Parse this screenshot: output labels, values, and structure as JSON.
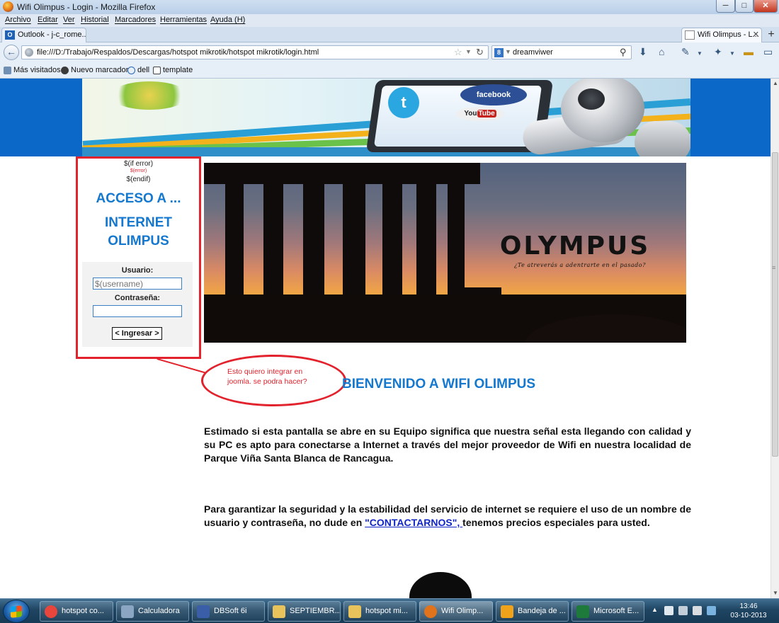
{
  "window": {
    "title": "Wifi Olimpus - Login - Mozilla Firefox",
    "minimize": "─",
    "maximize": "□",
    "close": "✕"
  },
  "menu": [
    "Archivo",
    "Editar",
    "Ver",
    "Historial",
    "Marcadores",
    "Herramientas",
    "Ayuda (H)"
  ],
  "tabs": [
    {
      "label": "Outlook - j-c_rome...",
      "icon": "outlook-icon"
    },
    {
      "label": "Wifi Olimpus - L...",
      "icon": "page-icon",
      "active": true
    }
  ],
  "newtab": "+",
  "nav": {
    "back": "←",
    "url": "file:///D:/Trabajo/Respaldos/Descargas/hotspot mikrotik/hotspot mikrotik/login.html",
    "search_query": "dreamviwer",
    "search_engine_glyph": "8"
  },
  "bookmarks": [
    "Más visitados",
    "Nuevo marcador",
    "dell",
    "template"
  ],
  "page": {
    "banner": {
      "twitter_glyph": "t",
      "facebook": "facebook",
      "youtube_you": "You",
      "youtube_tube": "Tube"
    },
    "login": {
      "if_error": "$(if error)",
      "error_var": "$(error)",
      "endif": "$(endif)",
      "title_line1": "ACCESO A ...",
      "title_line2": "INTERNET",
      "title_line3": "OLIMPUS",
      "username_label": "Usuario:",
      "username_placeholder": "$(username)",
      "password_label": "Contraseña:",
      "submit_label": "< Ingresar >"
    },
    "hero": {
      "brand": "OLYMPUS",
      "tagline": "¿Te atreverás a adentrarte en el pasado?"
    },
    "callout": "Esto quiero integrar en joomla. se podra hacer?",
    "welcome": "BIENVENIDO A WIFI OLIMPUS",
    "para1": "Estimado si esta pantalla se abre en su Equipo significa que nuestra señal esta llegando con calidad y su PC es apto para conectarse a Internet a través del mejor proveedor de Wifi en nuestra localidad de Parque Viña Santa Blanca de Rancagua.",
    "para2_before": "Para garantizar la seguridad y la estabilidad del servicio de internet se requiere el uso de un nombre de usuario y contraseña, no dude en ",
    "para2_link": "\"CONTACTARNOS\", ",
    "para2_after": "tenemos precios especiales para usted."
  },
  "taskbar": {
    "items": [
      {
        "label": "hotspot co...",
        "icon": "chrome-icon",
        "color": "#e8453c"
      },
      {
        "label": "Calculadora",
        "icon": "calculator-icon",
        "color": "#8aa6c2"
      },
      {
        "label": "DBSoft 6i",
        "icon": "dbsoft-icon",
        "color": "#3a5fa8"
      },
      {
        "label": "SEPTIEMBR...",
        "icon": "folder-icon",
        "color": "#e8c25a"
      },
      {
        "label": "hotspot mi...",
        "icon": "folder-icon",
        "color": "#e8c25a"
      },
      {
        "label": "Wifi Olimp...",
        "icon": "firefox-icon",
        "color": "#e0731b",
        "active": true
      },
      {
        "label": "Bandeja de ...",
        "icon": "outlook-icon",
        "color": "#f0a21a"
      },
      {
        "label": "Microsoft E...",
        "icon": "excel-icon",
        "color": "#1e7a3a"
      }
    ],
    "clock_time": "13:46",
    "clock_date": "03-10-2013"
  },
  "colors": {
    "accent_blue": "#1478cf",
    "callout_red": "#e2222c",
    "link_blue": "#1024c8"
  }
}
